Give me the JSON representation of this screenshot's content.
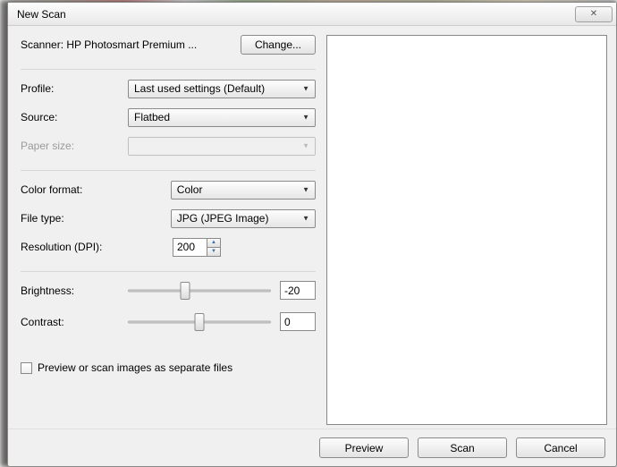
{
  "title": "New Scan",
  "scanner": {
    "label_prefix": "Scanner: ",
    "name": "HP Photosmart Premium ...",
    "change_label": "Change..."
  },
  "profile": {
    "label": "Profile:",
    "value": "Last used settings (Default)"
  },
  "source": {
    "label": "Source:",
    "value": "Flatbed"
  },
  "paper_size": {
    "label": "Paper size:",
    "value": ""
  },
  "color_format": {
    "label": "Color format:",
    "value": "Color"
  },
  "file_type": {
    "label": "File type:",
    "value": "JPG (JPEG Image)"
  },
  "resolution": {
    "label": "Resolution (DPI):",
    "value": "200"
  },
  "brightness": {
    "label": "Brightness:",
    "value": "-20",
    "percent": 40
  },
  "contrast": {
    "label": "Contrast:",
    "value": "0",
    "percent": 50
  },
  "separate_files": {
    "label": "Preview or scan images as separate files",
    "checked": false
  },
  "buttons": {
    "preview": "Preview",
    "scan": "Scan",
    "cancel": "Cancel"
  }
}
